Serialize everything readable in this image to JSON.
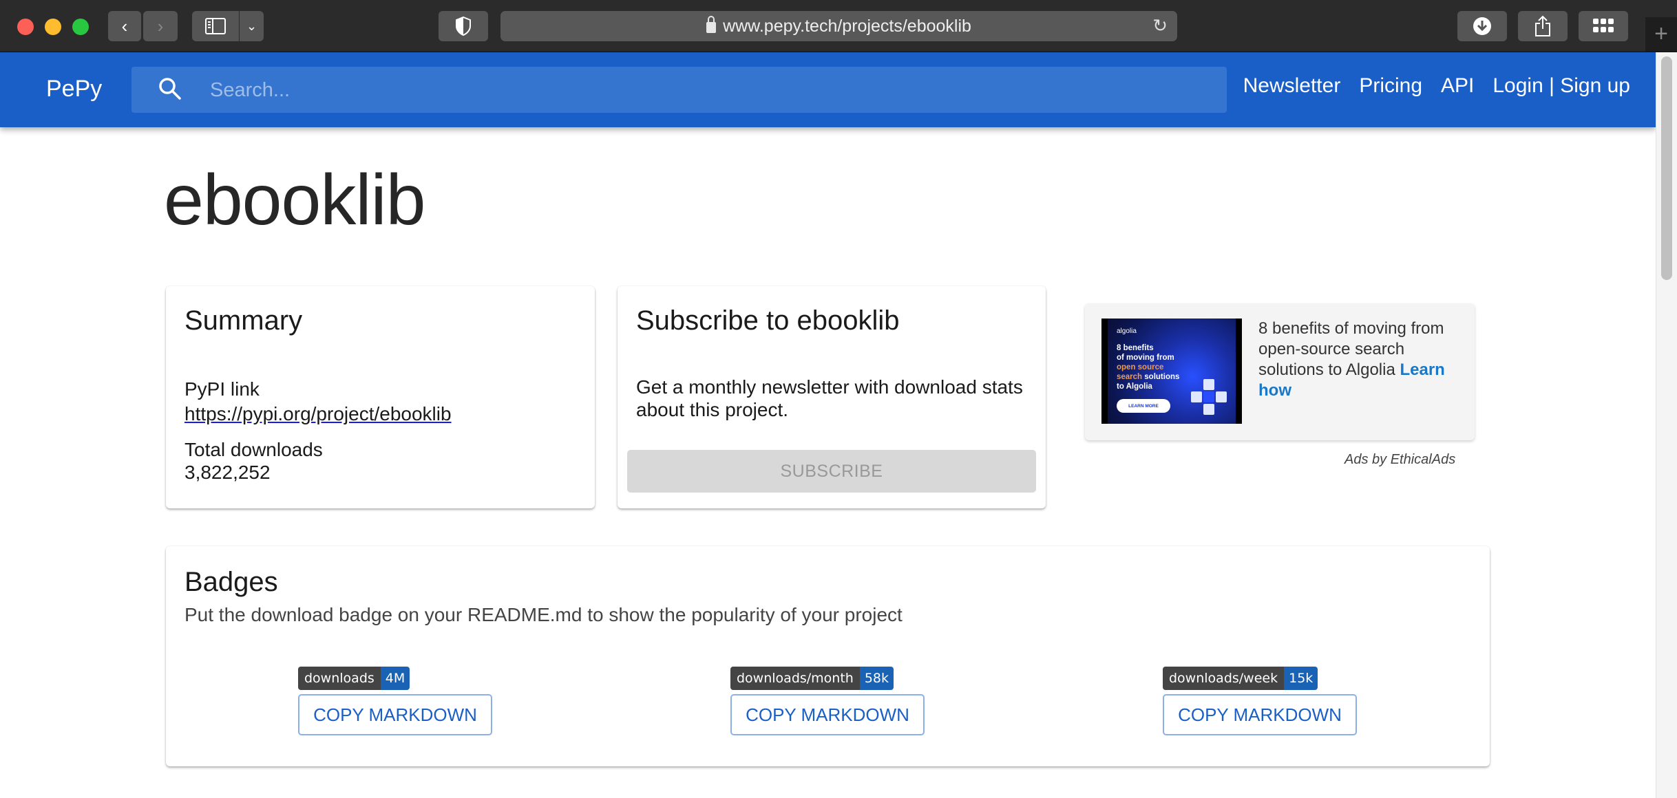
{
  "browser": {
    "url": "www.pepy.tech/projects/ebooklib",
    "icons": {
      "back": "chevron-left-icon",
      "forward": "chevron-right-icon",
      "sidebar": "sidebar-icon",
      "shield": "privacy-shield-icon",
      "reload": "reload-icon",
      "download": "download-icon",
      "share": "share-icon",
      "tabs": "tab-overview-icon",
      "newtab": "plus-icon"
    }
  },
  "nav": {
    "brand": "PePy",
    "search_placeholder": "Search...",
    "links": [
      "Newsletter",
      "Pricing",
      "API",
      "Login | Sign up"
    ],
    "color": "#1a5fc7"
  },
  "page": {
    "title": "ebooklib"
  },
  "summary": {
    "heading": "Summary",
    "pypi_label": "PyPI link",
    "pypi_url": "https://pypi.org/project/ebooklib",
    "total_label": "Total downloads",
    "total_value": "3,822,252"
  },
  "subscribe": {
    "heading": "Subscribe to ebooklib",
    "description": "Get a monthly newsletter with download stats about this project.",
    "button": "SUBSCRIBE"
  },
  "ad": {
    "image_logo": "algolia",
    "image_line1": "8 benefits",
    "image_line2": "of moving from",
    "image_line3_accent": "open source",
    "image_line4_accent": "search",
    "image_line4_rest": " solutions",
    "image_line5": "to Algolia",
    "image_button": "LEARN MORE",
    "text": "8 benefits of moving from open-source search solutions to Algolia ",
    "link": "Learn how",
    "attribution": "Ads by EthicalAds"
  },
  "badges": {
    "heading": "Badges",
    "description": "Put the download badge on your README.md to show the popularity of your project",
    "items": [
      {
        "label": "downloads",
        "value": "4M",
        "button": "COPY MARKDOWN"
      },
      {
        "label": "downloads/month",
        "value": "58k",
        "button": "COPY MARKDOWN"
      },
      {
        "label": "downloads/week",
        "value": "15k",
        "button": "COPY MARKDOWN"
      }
    ]
  }
}
